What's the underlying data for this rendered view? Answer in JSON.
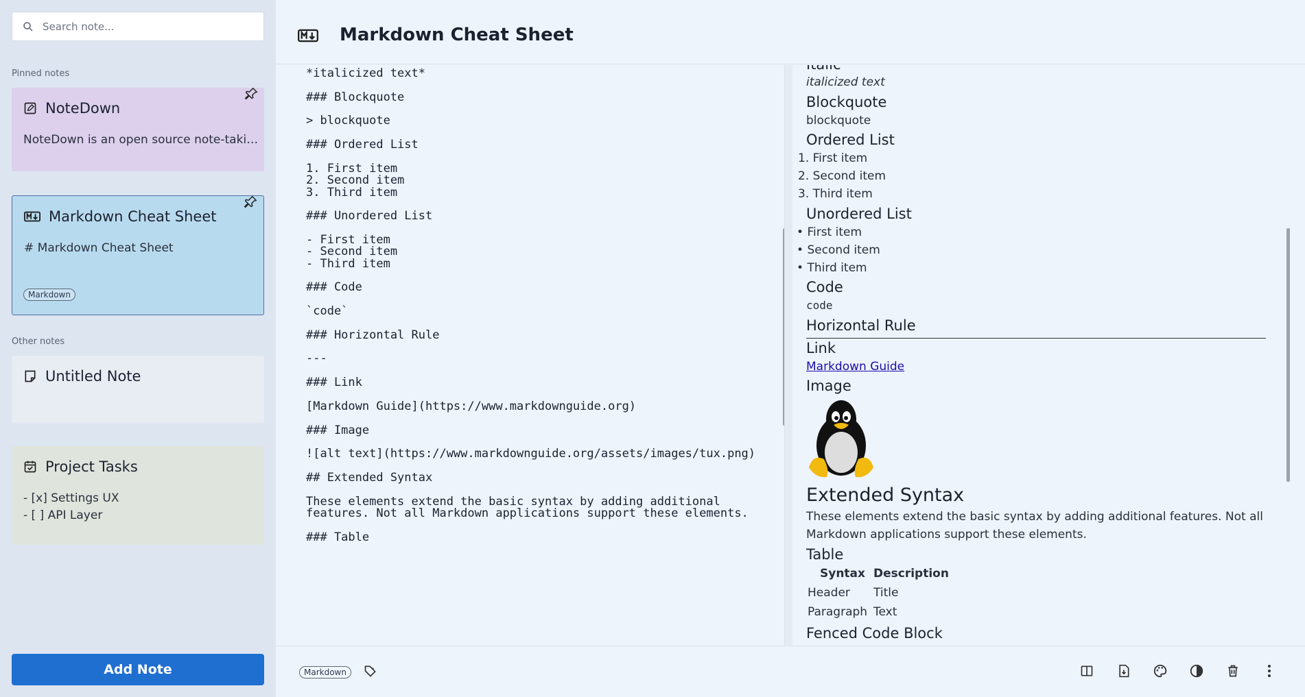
{
  "search": {
    "placeholder": "Search note..."
  },
  "sidebar": {
    "pinned_label": "Pinned notes",
    "other_label": "Other notes",
    "notes": [
      {
        "title": "NoteDown",
        "body": "NoteDown is an open source note-taking app",
        "color": "#dcd0ec",
        "icon": "edit-note-icon"
      },
      {
        "title": "Markdown Cheat Sheet",
        "body": "# Markdown Cheat Sheet",
        "tag": "Markdown",
        "color": "#b8daee",
        "icon": "markdown-icon"
      },
      {
        "title": "Untitled Note",
        "body": "",
        "color": "#e8ecf3",
        "icon": "note-icon"
      },
      {
        "title": "Project Tasks",
        "body_lines": [
          "- [x] Settings UX",
          "- [ ] API Layer"
        ],
        "color": "#dfe5dc",
        "icon": "checklist-icon"
      }
    ],
    "add_button": "Add Note"
  },
  "header": {
    "title": "Markdown Cheat Sheet"
  },
  "editor": {
    "lines": [
      "*italicized text*",
      "",
      "### Blockquote",
      "",
      "> blockquote",
      "",
      "### Ordered List",
      "",
      "1. First item",
      "2. Second item",
      "3. Third item",
      "",
      "### Unordered List",
      "",
      "- First item",
      "- Second item",
      "- Third item",
      "",
      "### Code",
      "",
      "`code`",
      "",
      "### Horizontal Rule",
      "",
      "---",
      "",
      "### Link",
      "",
      "[Markdown Guide](https://www.markdownguide.org)",
      "",
      "### Image",
      "",
      "![alt text](https://www.markdownguide.org/assets/images/tux.png)",
      "",
      "## Extended Syntax",
      "",
      "These elements extend the basic syntax by adding additional",
      "features. Not all Markdown applications support these elements.",
      "",
      "### Table"
    ]
  },
  "preview": {
    "italic_heading": "Italic",
    "italic_text": "italicized text",
    "blockquote_heading": "Blockquote",
    "blockquote_text": "blockquote",
    "ordered_heading": "Ordered List",
    "ordered_items": [
      "First item",
      "Second item",
      "Third item"
    ],
    "unordered_heading": "Unordered List",
    "unordered_items": [
      "First item",
      "Second item",
      "Third item"
    ],
    "code_heading": "Code",
    "code_text": "code",
    "hr_heading": "Horizontal Rule",
    "link_heading": "Link",
    "link_text": "Markdown Guide",
    "image_heading": "Image",
    "extended_heading": "Extended Syntax",
    "extended_text_1": "These elements extend the basic syntax by adding additional features. Not all",
    "extended_text_2": "Markdown applications support these elements.",
    "table_heading": "Table",
    "table": {
      "headers": [
        "Syntax",
        "Description"
      ],
      "rows": [
        [
          "Header",
          "Title"
        ],
        [
          "Paragraph",
          "Text"
        ]
      ]
    },
    "fenced_heading": "Fenced Code Block"
  },
  "footer": {
    "tag": "Markdown",
    "icons": [
      "tag-icon",
      "split-view-icon",
      "export-file-icon",
      "palette-icon",
      "contrast-icon",
      "delete-icon",
      "more-vert-icon"
    ]
  },
  "colors": {
    "accent": "#1f6fd1",
    "link": "#1a0dab"
  }
}
